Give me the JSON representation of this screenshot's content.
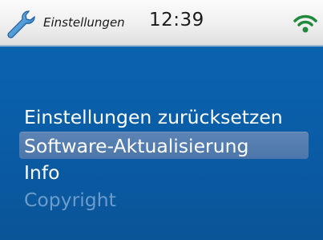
{
  "header": {
    "app_icon": "wrench-icon",
    "title": "Einstellungen",
    "time": "12:39",
    "signal_icon": "wifi-icon"
  },
  "menu": {
    "selected_index": 1,
    "items": [
      {
        "label": "Einstellungen zurücksetzen",
        "enabled": true
      },
      {
        "label": "Software-Aktualisierung",
        "enabled": true
      },
      {
        "label": "Info",
        "enabled": true
      },
      {
        "label": "Copyright",
        "enabled": false
      }
    ]
  },
  "colors": {
    "background": "#0a5ea8",
    "highlight": "#5277ab",
    "disabled_text": "#6b9ccc",
    "wifi": "#1f8a3a",
    "wrench": "#3a8fd6"
  }
}
